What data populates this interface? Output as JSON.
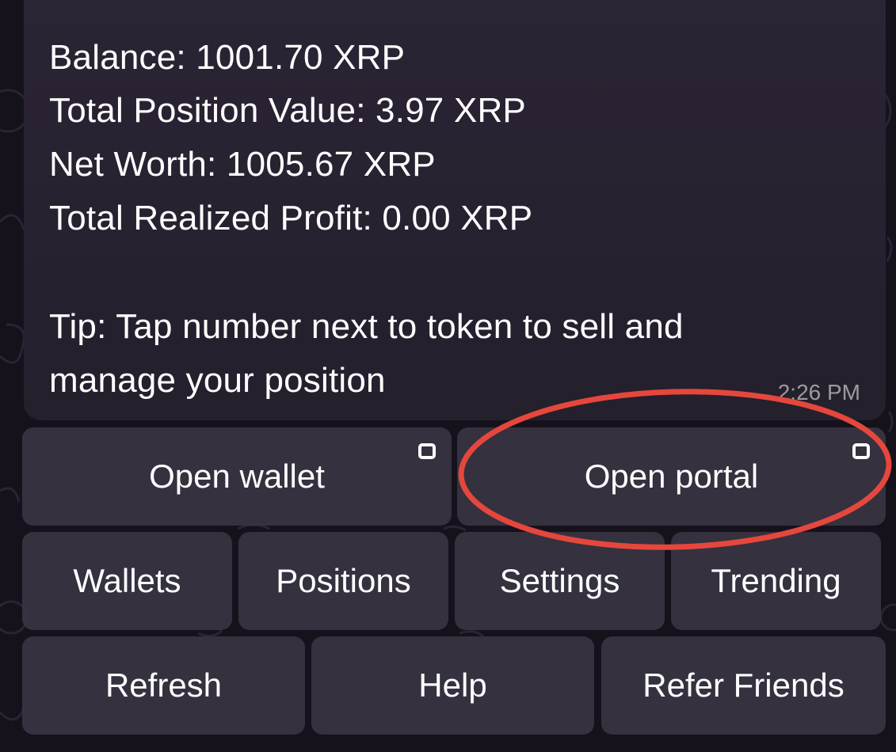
{
  "message": {
    "lines": [
      "Balance: 1001.70 XRP",
      "Total Position Value: 3.97 XRP",
      "Net Worth: 1005.67 XRP",
      "Total Realized Profit: 0.00 XRP",
      "Tip: Tap number next to token to sell and",
      "manage your position"
    ],
    "time": "2:26 PM"
  },
  "keyboard": {
    "row1": [
      {
        "label": "Open wallet",
        "icon": "webapp-icon"
      },
      {
        "label": "Open portal",
        "icon": "webapp-icon"
      }
    ],
    "row2": [
      "Wallets",
      "Positions",
      "Settings",
      "Trending"
    ],
    "row3": [
      "Refresh",
      "Help",
      "Refer Friends"
    ]
  },
  "colors": {
    "background": "#15121c",
    "bubble": "#2a2332",
    "button": "#3a3644",
    "text": "#ffffff",
    "annotation": "#e5473c"
  }
}
